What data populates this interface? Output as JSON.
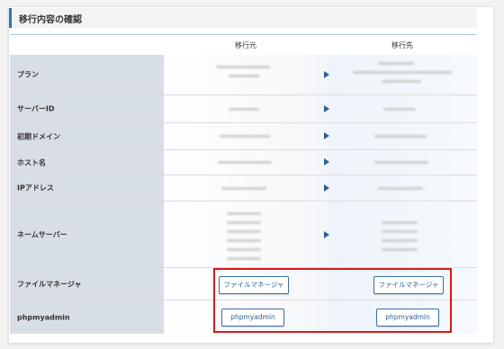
{
  "section": {
    "title": "移行内容の確認"
  },
  "columns": {
    "source": "移行元",
    "destination": "移行先"
  },
  "rows": {
    "plan": "プラン",
    "server_id": "サーバーID",
    "initial_domain": "初期ドメイン",
    "hostname": "ホスト名",
    "ip_address": "IPアドレス",
    "nameserver": "ネームサーバー",
    "file_manager": "ファイルマネージャ",
    "phpmyadmin": "phpmyadmin"
  },
  "buttons": {
    "file_manager_source": "ファイルマネージャ",
    "file_manager_destination": "ファイルマネージャ",
    "phpmyadmin_source": "phpmyadmin",
    "phpmyadmin_destination": "phpmyadmin"
  },
  "colors": {
    "accent": "#2e74b5",
    "highlight": "#d61a1a",
    "label_bg": "#d8dee6"
  },
  "icons": {
    "transfer": "arrow-right-icon"
  }
}
